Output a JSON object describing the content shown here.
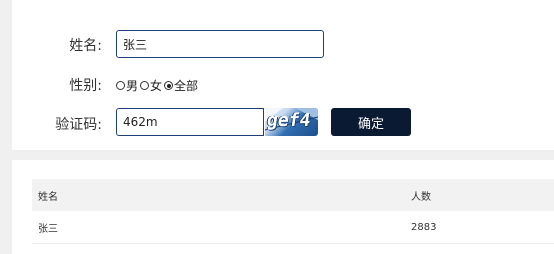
{
  "form": {
    "name_label": "姓名:",
    "name_value": "张三",
    "gender_label": "性别:",
    "gender_options": [
      {
        "label": "男",
        "checked": false
      },
      {
        "label": "女",
        "checked": false
      },
      {
        "label": "全部",
        "checked": true
      }
    ],
    "captcha_label": "验证码:",
    "captcha_value": "462m",
    "captcha_image_text": "gef4",
    "confirm_label": "确定"
  },
  "table": {
    "headers": [
      "姓名",
      "人数"
    ],
    "rows": [
      [
        "张三",
        "2883"
      ]
    ]
  },
  "colors": {
    "background": "#f0f0f0",
    "panel": "#ffffff",
    "input_border": "#1e3e7a",
    "button": "#0b1a33",
    "table_header": "#f2f2f2"
  }
}
